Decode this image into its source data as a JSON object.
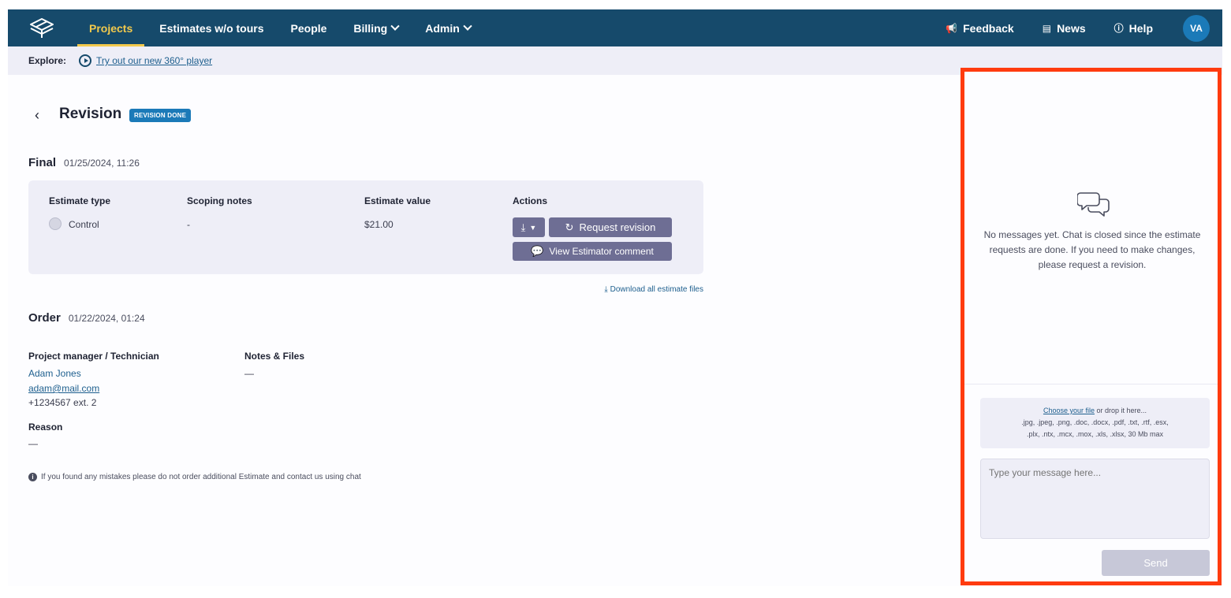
{
  "nav": {
    "logo_icon": "cube-logo-icon",
    "items": [
      {
        "label": "Projects",
        "active": true,
        "dropdown": false
      },
      {
        "label": "Estimates w/o tours",
        "active": false,
        "dropdown": false
      },
      {
        "label": "People",
        "active": false,
        "dropdown": false
      },
      {
        "label": "Billing",
        "active": false,
        "dropdown": true
      },
      {
        "label": "Admin",
        "active": false,
        "dropdown": true
      }
    ],
    "feedback_label": "Feedback",
    "news_label": "News",
    "help_label": "Help",
    "avatar_initials": "VA"
  },
  "explore": {
    "label": "Explore:",
    "link_text": "Try out our new 360° player"
  },
  "page": {
    "title": "Revision",
    "badge": "REVISION DONE"
  },
  "final": {
    "heading": "Final",
    "date": "01/25/2024, 11:26",
    "columns": {
      "type": "Estimate type",
      "notes": "Scoping notes",
      "value": "Estimate value",
      "actions": "Actions"
    },
    "row": {
      "type": "Control",
      "notes": "-",
      "value": "$21.00"
    },
    "request_revision_label": "Request revision",
    "view_comment_label": "View Estimator comment",
    "download_all_label": "Download all estimate files"
  },
  "order": {
    "heading": "Order",
    "date": "01/22/2024, 01:24",
    "pm_label": "Project manager / Technician",
    "pm_name": "Adam Jones",
    "pm_email": "adam@mail.com",
    "pm_phone": "+1234567 ext. 2",
    "notes_label": "Notes & Files",
    "notes_value": "—",
    "reason_label": "Reason",
    "reason_value": "—",
    "info_text": "If you found any mistakes please do not order additional Estimate and contact us using chat"
  },
  "chat": {
    "empty_text": "No messages yet. Chat is closed since the estimate requests are done. If you need to make changes, please request a revision.",
    "choose_file": "Choose your file",
    "drop_text": " or drop it here...",
    "file_types_1": ".jpg, .jpeg, .png, .doc, .docx, .pdf, .txt, .rtf, .esx,",
    "file_types_2": ".plx, .ntx, .mcx, .mox, .xls, .xlsx, 30 Mb max",
    "message_placeholder": "Type your message here...",
    "send_label": "Send"
  },
  "colors": {
    "nav_bg": "#164a6b",
    "active_nav": "#f2c94c",
    "badge": "#1b7ab8",
    "button": "#6e6e94",
    "highlight_border": "#ff3b0f"
  }
}
